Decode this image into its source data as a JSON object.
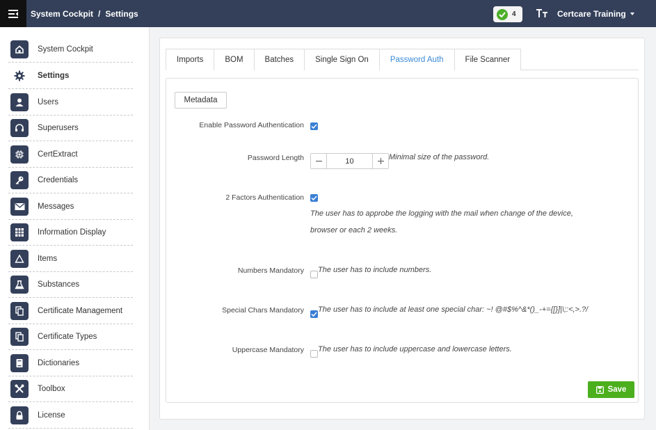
{
  "topbar": {
    "breadcrumb_root": "System Cockpit",
    "breadcrumb_sep": "/",
    "breadcrumb_current": "Settings",
    "status_count": "4",
    "org_name": "Certcare Training"
  },
  "sidebar": {
    "items": [
      {
        "label": "System Cockpit",
        "icon": "home-icon"
      },
      {
        "label": "Settings",
        "icon": "gear-icon"
      },
      {
        "label": "Users",
        "icon": "user-icon"
      },
      {
        "label": "Superusers",
        "icon": "headset-icon"
      },
      {
        "label": "CertExtract",
        "icon": "chip-icon"
      },
      {
        "label": "Credentials",
        "icon": "key-icon"
      },
      {
        "label": "Messages",
        "icon": "envelope-icon"
      },
      {
        "label": "Information Display",
        "icon": "table-icon"
      },
      {
        "label": "Items",
        "icon": "triangle-icon"
      },
      {
        "label": "Substances",
        "icon": "flask-icon"
      },
      {
        "label": "Certificate Management",
        "icon": "copy-icon"
      },
      {
        "label": "Certificate Types",
        "icon": "copy-icon"
      },
      {
        "label": "Dictionaries",
        "icon": "book-icon"
      },
      {
        "label": "Toolbox",
        "icon": "tools-icon"
      },
      {
        "label": "License",
        "icon": "lock-icon"
      }
    ]
  },
  "tabs": [
    "Imports",
    "BOM",
    "Batches",
    "Single Sign On",
    "Password Auth",
    "File Scanner"
  ],
  "form": {
    "metadata_label": "Metadata",
    "enable_label": "Enable Password Authentication",
    "length_label": "Password Length",
    "length_value": "10",
    "length_hint": "Minimal size of the password.",
    "twofa_label": "2 Factors Authentication",
    "twofa_hint_1": "The user has to approbe the logging with the mail when change of the device,",
    "twofa_hint_2": "browser or each 2 weeks.",
    "numbers_label": "Numbers Mandatory",
    "numbers_hint": "The user has to include numbers.",
    "special_label": "Special Chars Mandatory",
    "special_hint": "The user has to include at least one special char: ~! @#$%^&*()_-+={[}]|\\;:<,>.?/",
    "upper_label": "Uppercase Mandatory",
    "upper_hint": "The user has to include uppercase and lowercase letters.",
    "save_label": "Save"
  },
  "colors": {
    "topbar": "#34405a",
    "accent": "#3a8ad6",
    "save": "#4caf1e",
    "status_ok": "#4caf2a"
  }
}
